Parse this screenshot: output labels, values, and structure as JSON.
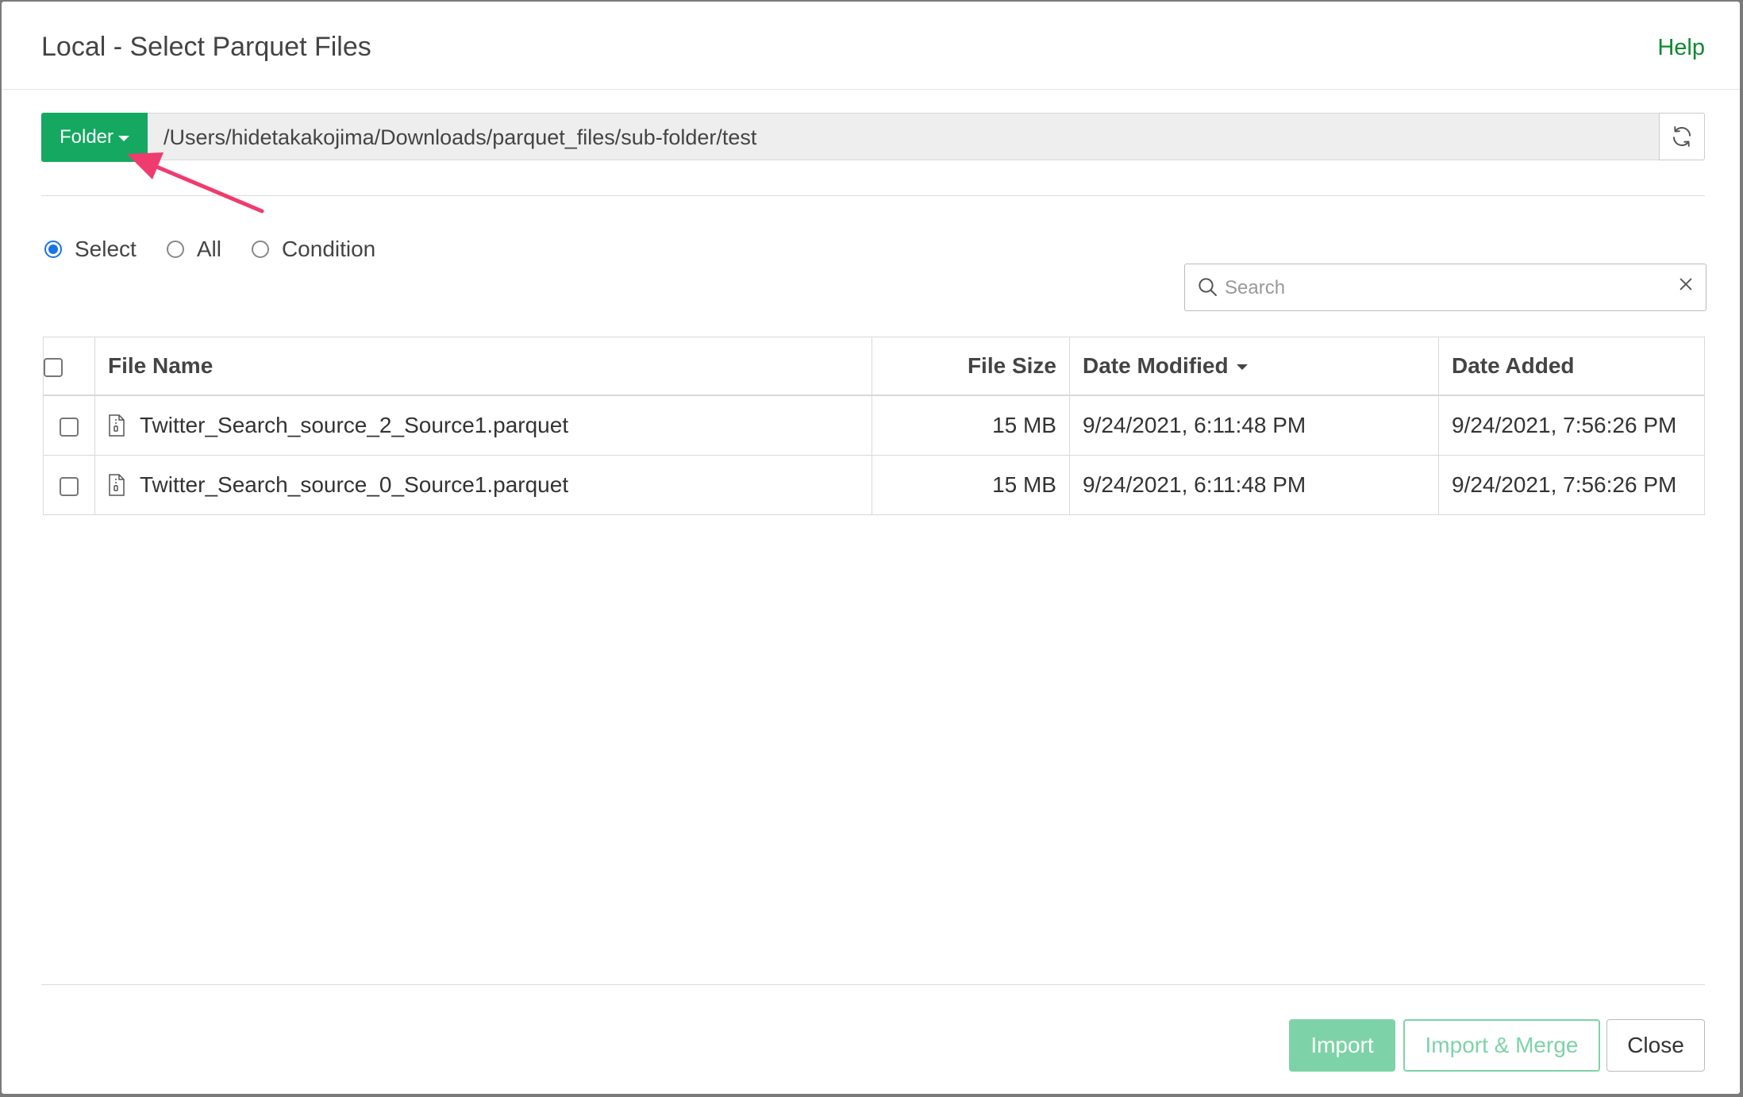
{
  "dialog": {
    "title": "Local - Select Parquet Files",
    "help_label": "Help"
  },
  "path_bar": {
    "folder_button_label": "Folder",
    "path": "/Users/hidetakakojima/Downloads/parquet_files/sub-folder/test"
  },
  "selection_modes": [
    {
      "label": "Select",
      "checked": true
    },
    {
      "label": "All",
      "checked": false
    },
    {
      "label": "Condition",
      "checked": false
    }
  ],
  "search": {
    "placeholder": "Search",
    "value": ""
  },
  "table": {
    "columns": {
      "name": "File Name",
      "size": "File Size",
      "modified": "Date Modified",
      "added": "Date Added"
    },
    "sort_column": "modified",
    "rows": [
      {
        "name": "Twitter_Search_source_2_Source1.parquet",
        "size": "15 MB",
        "modified": "9/24/2021, 6:11:48 PM",
        "added": "9/24/2021, 7:56:26 PM"
      },
      {
        "name": "Twitter_Search_source_0_Source1.parquet",
        "size": "15 MB",
        "modified": "9/24/2021, 6:11:48 PM",
        "added": "9/24/2021, 7:56:26 PM"
      }
    ]
  },
  "footer": {
    "import_label": "Import",
    "import_merge_label": "Import & Merge",
    "close_label": "Close"
  },
  "colors": {
    "accent_green": "#15a860",
    "disabled_green": "#7dd3a7",
    "help_link": "#0e8a2e",
    "annotation_arrow": "#ef3b6e"
  },
  "icons": [
    "caret-down-icon",
    "refresh-icon",
    "search-icon",
    "clear-icon",
    "file-icon",
    "sort-desc-icon"
  ]
}
